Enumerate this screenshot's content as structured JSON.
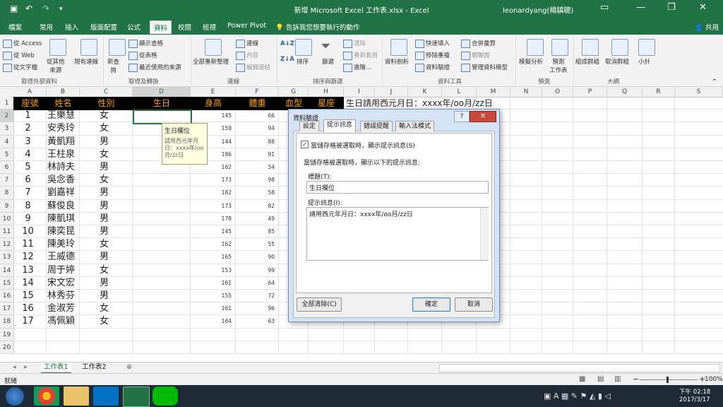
{
  "window": {
    "title": "新增 Microsoft Excel 工作表.xlsx - Excel",
    "user": "leonardyang(楊鎮聰)"
  },
  "tabs": [
    "檔案",
    "常用",
    "插入",
    "版面配置",
    "公式",
    "資料",
    "校閱",
    "檢視",
    "Power Pivot"
  ],
  "active_tab": "資料",
  "tell_me": "告訴我您想要執行的動作",
  "share": "共用",
  "ribbon": {
    "access": "從 Access",
    "web": "從 Web",
    "text": "從文字檔",
    "other": "從其他\n來源",
    "existing": "現有連線",
    "new_query": "新查\n詢",
    "show_queries": "顯示查格",
    "from_table": "從表格",
    "recent_sources": "最近使用的來源",
    "refresh_all": "全部重新整理",
    "connections": "連線",
    "properties": "內容",
    "edit_links": "編輯連結",
    "sort": "排序",
    "filter": "篩選",
    "clear": "清除",
    "reapply": "重新套用",
    "advanced": "進階...",
    "text_to_cols": "資料剖析",
    "flash_fill": "快速填入",
    "remove_dup": "移除重複",
    "data_valid": "資料驗證",
    "consolidate": "合併彙算",
    "relationships": "關聯圖",
    "data_model": "管理資料模型",
    "whatif": "模擬分析",
    "forecast": "預測\n工作表",
    "group": "組成群組",
    "ungroup": "取消群組",
    "subtotal": "小計",
    "groups": [
      "取得外部資料",
      "取得及轉換",
      "連線",
      "排序與篩選",
      "資料工具",
      "預測",
      "大綱"
    ]
  },
  "columns": [
    "A",
    "B",
    "C",
    "D",
    "E",
    "F",
    "G",
    "H",
    "I",
    "J",
    "K",
    "L",
    "M",
    "N",
    "O",
    "P",
    "Q",
    "R",
    "S"
  ],
  "header_row": [
    "座號",
    "姓名",
    "性別",
    "生日",
    "身高",
    "體重",
    "血型",
    "星座"
  ],
  "note_cell": "生日請用西元月日：xxxx年/oo月/zz日",
  "rows": [
    {
      "n": "1",
      "name": "王樂慧",
      "sex": "女",
      "h": "145",
      "w": "66"
    },
    {
      "n": "2",
      "name": "安秀玲",
      "sex": "女",
      "h": "159",
      "w": "94"
    },
    {
      "n": "3",
      "name": "黃凱翔",
      "sex": "男",
      "h": "144",
      "w": "88"
    },
    {
      "n": "4",
      "name": "王柱泉",
      "sex": "女",
      "h": "186",
      "w": "91"
    },
    {
      "n": "5",
      "name": "林詩夫",
      "sex": "男",
      "h": "162",
      "w": "54"
    },
    {
      "n": "6",
      "name": "吳念香",
      "sex": "女",
      "h": "173",
      "w": "98"
    },
    {
      "n": "7",
      "name": "劉嘉祥",
      "sex": "男",
      "h": "182",
      "w": "58"
    },
    {
      "n": "8",
      "name": "蘇俊良",
      "sex": "男",
      "h": "173",
      "w": "82"
    },
    {
      "n": "9",
      "name": "陳凱琪",
      "sex": "男",
      "h": "178",
      "w": "49"
    },
    {
      "n": "10",
      "name": "陳奕昆",
      "sex": "男",
      "h": "145",
      "w": "85"
    },
    {
      "n": "11",
      "name": "陳美玲",
      "sex": "女",
      "h": "162",
      "w": "55"
    },
    {
      "n": "12",
      "name": "王威德",
      "sex": "男",
      "h": "165",
      "w": "90"
    },
    {
      "n": "13",
      "name": "周于婷",
      "sex": "女",
      "h": "153",
      "w": "99"
    },
    {
      "n": "14",
      "name": "宋文宏",
      "sex": "男",
      "h": "161",
      "w": "64"
    },
    {
      "n": "15",
      "name": "林秀芬",
      "sex": "男",
      "h": "155",
      "w": "72"
    },
    {
      "n": "16",
      "name": "金淑芳",
      "sex": "女",
      "h": "161",
      "w": "96"
    },
    {
      "n": "17",
      "name": "馮佩穎",
      "sex": "女",
      "h": "164",
      "w": "63"
    }
  ],
  "tooltip": {
    "title": "生日欄位",
    "body": "請用西元年月日：xxxx年/oo月/zz日"
  },
  "dialog": {
    "title": "資料驗證",
    "tabs": [
      "設定",
      "提示訊息",
      "錯誤提醒",
      "輸入法模式"
    ],
    "active_tab": "提示訊息",
    "checkbox_label": "當儲存格被選取時，顯示提示訊息(S)",
    "section_label": "當儲存格被選取時，顯示以下的提示訊息:",
    "title_label": "標題(T):",
    "title_value": "生日欄位",
    "msg_label": "提示訊息(I):",
    "msg_value": "請用西元年月日：xxxx年/oo月/zz日",
    "clear_all": "全部清除(C)",
    "ok": "確定",
    "cancel": "取消"
  },
  "sheets": [
    "工作表1",
    "工作表2"
  ],
  "status": "就緒",
  "zoom": "100%",
  "clock": {
    "time": "下午 02:18",
    "date": "2017/3/17"
  }
}
